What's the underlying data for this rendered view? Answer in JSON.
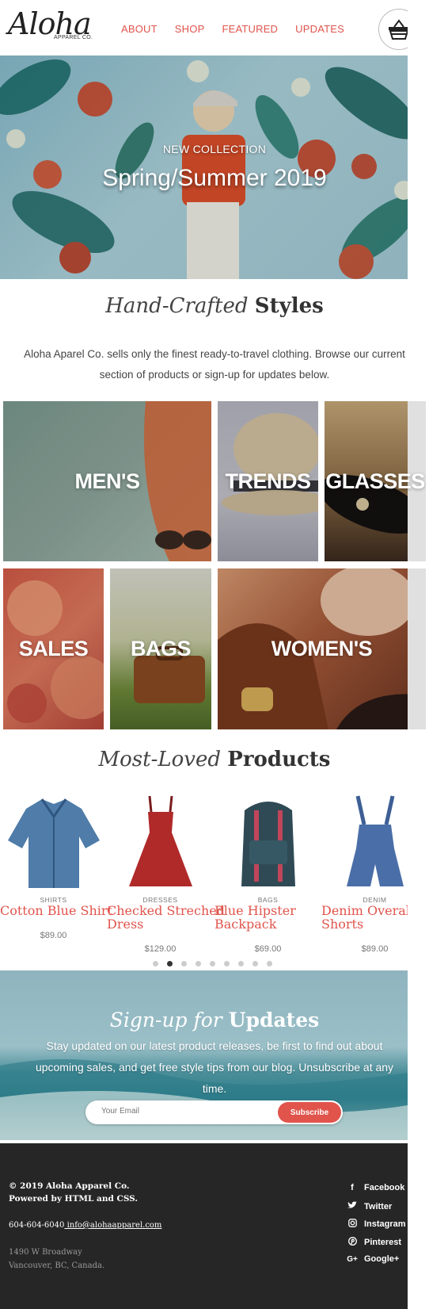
{
  "header": {
    "logo": "Aloha",
    "logo_sub": "APPAREL CO.",
    "nav": [
      "ABOUT",
      "SHOP",
      "FEATURED",
      "UPDATES"
    ],
    "cart_icon": "basket-icon"
  },
  "hero": {
    "kicker": "NEW COLLECTION",
    "title": "Spring/Summer 2019"
  },
  "intro": {
    "title_italic": "Hand-Crafted",
    "title_bold": "Styles",
    "text": "Aloha Aparel Co. sells only the finest ready-to-travel clothing. Browse our current section of products or sign-up for updates below."
  },
  "categories": [
    "MEN'S",
    "TRENDS",
    "GLASSES",
    "SALES",
    "BAGS",
    "WOMEN'S"
  ],
  "products_section": {
    "title_italic": "Most-Loved",
    "title_bold": "Products",
    "items": [
      {
        "category": "SHIRTS",
        "name": "Cotton Blue Shirt",
        "price": "$89.00"
      },
      {
        "category": "DRESSES",
        "name": "Checked Streched Dress",
        "price": "$129.00"
      },
      {
        "category": "BAGS",
        "name": "Blue Hipster Backpack",
        "price": "$69.00"
      },
      {
        "category": "DENIM",
        "name": "Denim Overall Shorts",
        "price": "$89.00"
      }
    ],
    "carousel_active_index": 1,
    "carousel_count": 9
  },
  "signup": {
    "title_italic": "Sign-up for",
    "title_bold": "Updates",
    "text": "Stay updated on our latest product releases, be first to find out about upcoming sales, and get free style tips from our blog. Unsubscribe at any time.",
    "placeholder": "Your Email",
    "button": "Subscribe"
  },
  "footer": {
    "copyright": "© 2019 Aloha Apparel Co.",
    "powered": "Powered by HTML and CSS.",
    "phone": "604-604-6040",
    "email": " info@alohaapparel.com",
    "address1": "1490 W Broadway",
    "address2": "Vancouver, BC, Canada.",
    "social": [
      "Facebook",
      "Twitter",
      "Instagram",
      "Pinterest",
      "Google+"
    ]
  },
  "colors": {
    "accent": "#e0544c",
    "footer_bg": "#262626"
  }
}
